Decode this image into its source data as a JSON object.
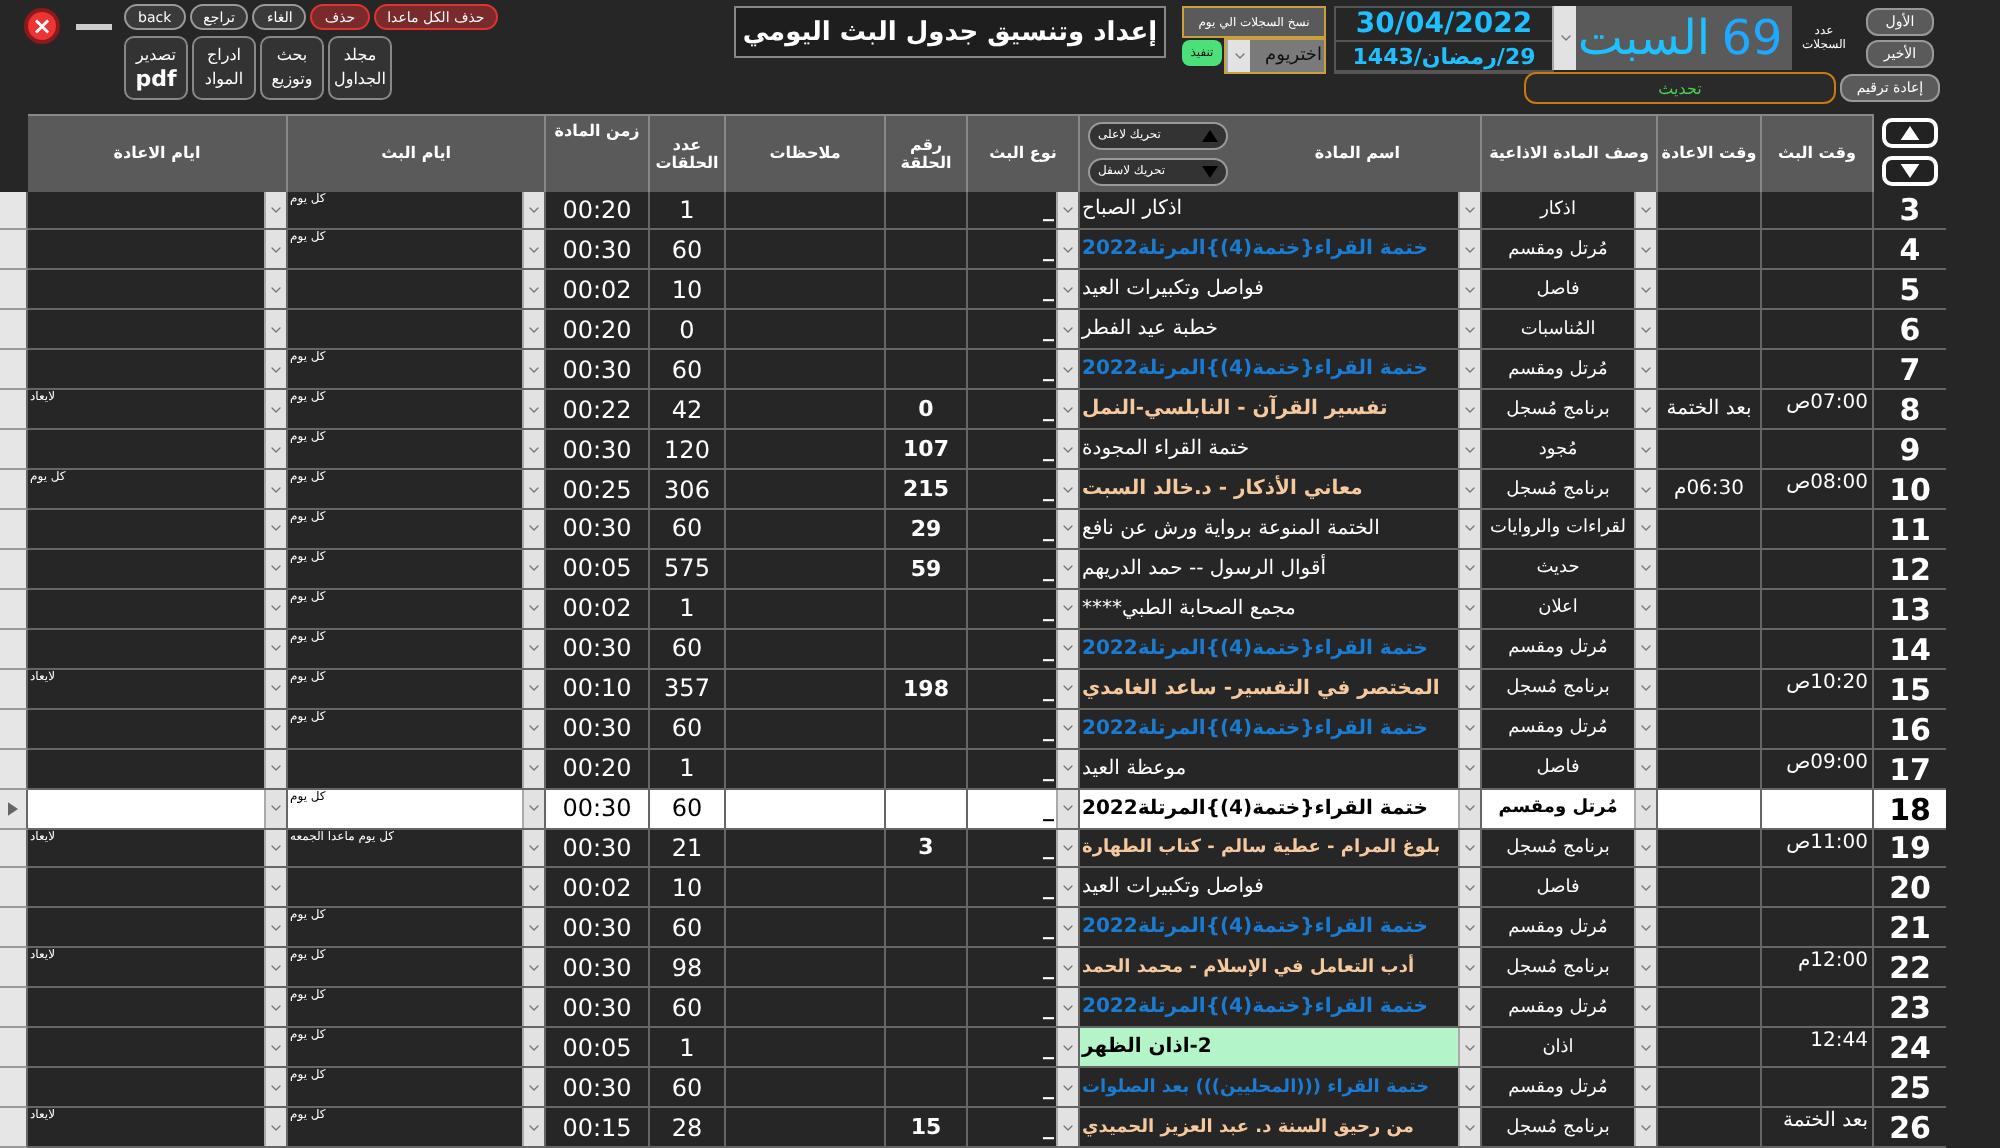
{
  "window_controls": {
    "close": "×"
  },
  "toolbar": {
    "top_buttons": [
      {
        "label": "حذف الكل ماعدا",
        "kind": "danger"
      },
      {
        "label": "حذف",
        "kind": "danger"
      },
      {
        "label": "الغاء",
        "kind": "plain"
      },
      {
        "label": "تراجع",
        "kind": "plain"
      },
      {
        "label": "back",
        "kind": "plain"
      }
    ],
    "big_buttons": [
      {
        "line1": "مجلد",
        "line2": "الجداول"
      },
      {
        "line1": "بحث",
        "line2": "وتوزيع"
      },
      {
        "line1": "ادراج",
        "line2": "المواد"
      },
      {
        "line1": "تصدير",
        "line2": "pdf"
      }
    ]
  },
  "title": "إعداد وتنسيق جدول البث اليومي",
  "copy": {
    "label": "نسخ السجلات الي يوم",
    "day_select": "اختريوم",
    "run_button": "تنفيذ"
  },
  "date": {
    "gregorian": "30/04/2022",
    "hijri": "29/رمضان/1443"
  },
  "day": "السبت",
  "records": {
    "count": "69",
    "label": "عدد السجلات"
  },
  "nav": {
    "first": "الأول",
    "last": "الأخير",
    "renumber": "إعادة ترقيم",
    "refresh": "تحديث"
  },
  "move": {
    "up": "تحريك لاعلى",
    "down": "تحريك لاسفل"
  },
  "table": {
    "columns": {
      "time": "وقت البث",
      "rerun_time": "وقت الاعادة",
      "description": "وصف المادة الاذاعية",
      "name": "اسم المادة",
      "type": "نوع البث",
      "episode": "رقم الحلقة",
      "notes": "ملاحظات",
      "count": "عدد الحلقات",
      "duration": "زمن المادة",
      "days": "ايام البث",
      "rerun_days": "ايام الاعادة"
    },
    "rows": [
      {
        "number": "3",
        "description": "اذكار",
        "name": "اذكار الصباح",
        "color": "#ffffff",
        "highlighted": false,
        "selected": false,
        "type": "_",
        "count": "1",
        "duration": "00:20",
        "days": "كل يوم"
      },
      {
        "number": "4",
        "description": "مُرتل ومقسم",
        "name": "ختمة القراء{ختمة(4)}المرتلة2022",
        "color": "#1a7bd1",
        "highlighted": false,
        "selected": false,
        "type": "_",
        "count": "60",
        "duration": "00:30",
        "days": "كل يوم"
      },
      {
        "number": "5",
        "description": "فاصل",
        "name": "فواصل وتكبيرات العيد",
        "color": "#ffffff",
        "highlighted": false,
        "selected": false,
        "type": "_",
        "count": "10",
        "duration": "00:02"
      },
      {
        "number": "6",
        "description": "المُناسبات",
        "name": "خطبة عيد الفطر",
        "color": "#ffffff",
        "highlighted": false,
        "selected": false,
        "type": "_",
        "count": "0",
        "duration": "00:20"
      },
      {
        "number": "7",
        "description": "مُرتل ومقسم",
        "name": "ختمة القراء{ختمة(4)}المرتلة2022",
        "color": "#1a7bd1",
        "highlighted": false,
        "selected": false,
        "type": "_",
        "count": "60",
        "duration": "00:30",
        "days": "كل يوم"
      },
      {
        "number": "8",
        "time": "07:00ص",
        "rerun_time": "بعد الختمة",
        "description": "برنامج مُسجل",
        "name": "تفسير القرآن - النابلسي-النمل",
        "color": "#f5c9a0",
        "highlighted": false,
        "selected": false,
        "type": "_",
        "episode": "0",
        "count": "42",
        "duration": "00:22",
        "days": "كل يوم",
        "rerun_days": "لايعاد"
      },
      {
        "number": "9",
        "description": "مُجود",
        "name": "ختمة القراء المجودة",
        "color": "#ffffff",
        "highlighted": false,
        "selected": false,
        "type": "_",
        "episode": "107",
        "count": "120",
        "duration": "00:30",
        "days": "كل يوم"
      },
      {
        "number": "10",
        "time": "08:00ص",
        "rerun_time": "06:30م",
        "description": "برنامج مُسجل",
        "name": "معاني الأذكار - د.خالد السبت",
        "color": "#f5c9a0",
        "highlighted": false,
        "selected": false,
        "type": "_",
        "episode": "215",
        "count": "306",
        "duration": "00:25",
        "days": "كل يوم",
        "rerun_days": "كل يوم"
      },
      {
        "number": "11",
        "description": "لقراءات والروايات",
        "name": "الختمة المنوعة برواية ورش عن نافع",
        "color": "#ffffff",
        "highlighted": false,
        "selected": false,
        "type": "_",
        "episode": "29",
        "count": "60",
        "duration": "00:30",
        "days": "كل يوم"
      },
      {
        "number": "12",
        "description": "حديث",
        "name": "أقوال الرسول -- حمد الدريهم",
        "color": "#ffffff",
        "highlighted": false,
        "selected": false,
        "type": "_",
        "episode": "59",
        "count": "575",
        "duration": "00:05",
        "days": "كل يوم"
      },
      {
        "number": "13",
        "description": "اعلان",
        "name": "مجمع الصحابة الطبي****",
        "color": "#ffffff",
        "highlighted": false,
        "selected": false,
        "type": "_",
        "count": "1",
        "duration": "00:02",
        "days": "كل يوم"
      },
      {
        "number": "14",
        "description": "مُرتل ومقسم",
        "name": "ختمة القراء{ختمة(4)}المرتلة2022",
        "color": "#1a7bd1",
        "highlighted": false,
        "selected": false,
        "type": "_",
        "count": "60",
        "duration": "00:30",
        "days": "كل يوم"
      },
      {
        "number": "15",
        "time": "10:20ص",
        "description": "برنامج مُسجل",
        "name": "المختصر في التفسير- ساعد الغامدي",
        "color": "#f5c9a0",
        "highlighted": false,
        "selected": false,
        "type": "_",
        "episode": "198",
        "count": "357",
        "duration": "00:10",
        "days": "كل يوم",
        "rerun_days": "لايعاد"
      },
      {
        "number": "16",
        "description": "مُرتل ومقسم",
        "name": "ختمة القراء{ختمة(4)}المرتلة2022",
        "color": "#1a7bd1",
        "highlighted": false,
        "selected": false,
        "type": "_",
        "count": "60",
        "duration": "00:30",
        "days": "كل يوم"
      },
      {
        "number": "17",
        "time": "09:00ص",
        "description": "فاصل",
        "name": "موعظة العيد",
        "color": "#ffffff",
        "highlighted": false,
        "selected": false,
        "type": "_",
        "count": "1",
        "duration": "00:20"
      },
      {
        "number": "18",
        "description": "مُرتل ومقسم",
        "name": "ختمة القراء{ختمة(4)}المرتلة2022",
        "color": "#000000",
        "highlighted": false,
        "selected": true,
        "type": "_",
        "count": "60",
        "duration": "00:30",
        "days": "كل يوم"
      },
      {
        "number": "19",
        "time": "11:00ص",
        "description": "برنامج مُسجل",
        "name": "بلوغ المرام - عطية سالم - كتاب الطهارة",
        "color": "#f5c9a0",
        "highlighted": false,
        "selected": false,
        "type": "_",
        "episode": "3",
        "count": "21",
        "duration": "00:30",
        "days": "كل يوم ماعدا الجمعه",
        "rerun_days": "لايعاد"
      },
      {
        "number": "20",
        "description": "فاصل",
        "name": "فواصل وتكبيرات العيد",
        "color": "#ffffff",
        "highlighted": false,
        "selected": false,
        "type": "_",
        "count": "10",
        "duration": "00:02"
      },
      {
        "number": "21",
        "description": "مُرتل ومقسم",
        "name": "ختمة القراء{ختمة(4)}المرتلة2022",
        "color": "#1a7bd1",
        "highlighted": false,
        "selected": false,
        "type": "_",
        "count": "60",
        "duration": "00:30",
        "days": "كل يوم"
      },
      {
        "number": "22",
        "time": "12:00م",
        "description": "برنامج مُسجل",
        "name": "أدب التعامل في الإسلام - محمد الحمد",
        "color": "#f5c9a0",
        "highlighted": false,
        "selected": false,
        "type": "_",
        "count": "98",
        "duration": "00:30",
        "days": "كل يوم",
        "rerun_days": "لايعاد"
      },
      {
        "number": "23",
        "description": "مُرتل ومقسم",
        "name": "ختمة القراء{ختمة(4)}المرتلة2022",
        "color": "#1a7bd1",
        "highlighted": false,
        "selected": false,
        "type": "_",
        "count": "60",
        "duration": "00:30",
        "days": "كل يوم"
      },
      {
        "number": "24",
        "time": "12:44",
        "description": "اذان",
        "name": "2-اذان الظهر",
        "color": "#000000",
        "highlighted": true,
        "selected": false,
        "type": "_",
        "count": "1",
        "duration": "00:05",
        "days": "كل يوم"
      },
      {
        "number": "25",
        "description": "مُرتل ومقسم",
        "name": "ختمة القراء (((المحليين))) بعد الصلوات",
        "color": "#1a7bd1",
        "highlighted": false,
        "selected": false,
        "type": "_",
        "count": "60",
        "duration": "00:30",
        "days": "كل يوم"
      },
      {
        "number": "26",
        "time": "بعد الختمة",
        "description": "برنامج مُسجل",
        "name": "من رحيق السنة د. عبد العزيز الحميدي",
        "color": "#f5c9a0",
        "highlighted": false,
        "selected": false,
        "type": "_",
        "episode": "15",
        "count": "28",
        "duration": "00:15",
        "days": "كل يوم",
        "rerun_days": "لايعاد"
      }
    ]
  }
}
